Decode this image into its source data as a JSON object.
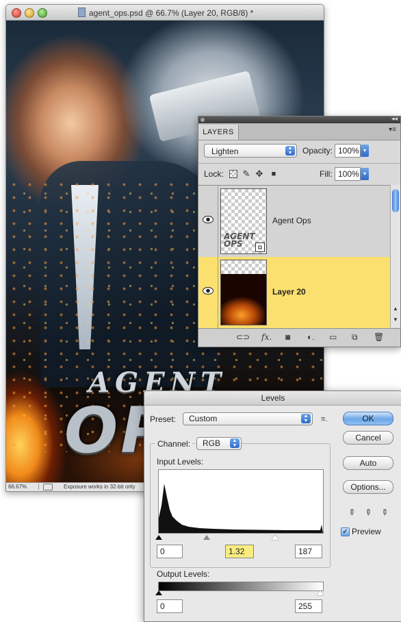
{
  "document": {
    "title": "agent_ops.psd @ 66.7% (Layer 20, RGB/8) *",
    "poster_title_line1": "AGENT",
    "poster_title_line2": "OPS",
    "status_zoom": "66.67%",
    "status_message": "Exposure works in 32-bit only"
  },
  "layers_panel": {
    "tab": "LAYERS",
    "blend_mode": "Lighten",
    "opacity_label": "Opacity:",
    "opacity_value": "100%",
    "lock_label": "Lock:",
    "fill_label": "Fill:",
    "fill_value": "100%",
    "layers": [
      {
        "name": "Agent Ops",
        "thumb_text": "AGENT OPS",
        "selected": false
      },
      {
        "name": "Layer 20",
        "selected": true
      }
    ],
    "selected_color": "#fbe06f",
    "footer_icons": [
      "link-icon",
      "fx-icon",
      "layer-mask-icon",
      "adjustment-layer-icon",
      "group-folder-icon",
      "new-layer-icon",
      "trash-icon"
    ]
  },
  "levels": {
    "title": "Levels",
    "preset_label": "Preset:",
    "preset_value": "Custom",
    "channel_label": "Channel:",
    "channel_value": "RGB",
    "input_levels_label": "Input Levels:",
    "input_black": "0",
    "input_gamma": "1.32",
    "input_white": "187",
    "output_levels_label": "Output Levels:",
    "output_black": "0",
    "output_white": "255",
    "buttons": {
      "ok": "OK",
      "cancel": "Cancel",
      "auto": "Auto",
      "options": "Options..."
    },
    "preview_label": "Preview",
    "preview_checked": true,
    "accent_color": "#6aa6e8"
  }
}
